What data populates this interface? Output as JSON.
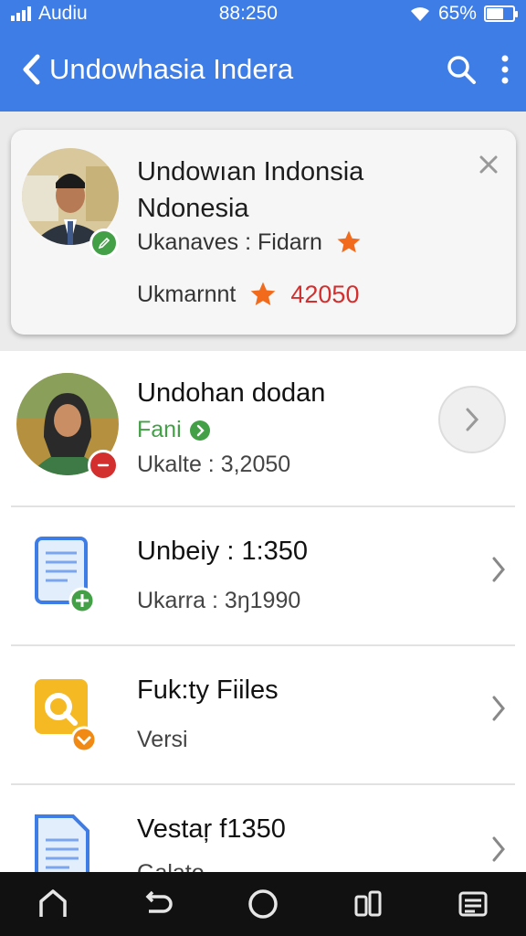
{
  "status_bar": {
    "carrier": "Audiu",
    "time": "88:250",
    "battery_percent": "65%",
    "battery_level": 0.65
  },
  "app_bar": {
    "back_icon": "chevron-left-icon",
    "title": "Undowhasia Indera",
    "actions": [
      "search-icon",
      "more-vertical-icon"
    ]
  },
  "profile_card": {
    "name_line1": "Undowıan Indonsia",
    "name_line2": "Ndonesia",
    "line1_text": "Ukanaves : Fidarn",
    "line2_label": "Ukmarnnt",
    "line2_value": "42050",
    "star_color": "#f26b1d",
    "close_icon": "close-icon"
  },
  "list": [
    {
      "title": "Undohan dodan",
      "status": "Fani",
      "status_color": "#43a047",
      "sub": "Ukalte : 3,2050",
      "icon": "avatar-photo"
    },
    {
      "title": "Unbeiy : 1:350",
      "sub": "Ukarra : 3ŋ1990",
      "icon": "document-add-icon"
    },
    {
      "title": "Fuk:ty Fiiles",
      "sub": "Versi",
      "icon": "folder-search-icon"
    },
    {
      "title": "Vestaŗ f1350",
      "sub": "Galato",
      "icon": "document-icon"
    }
  ],
  "nav_bar": [
    "home-icon",
    "back-icon",
    "circle-home-icon",
    "recents-icon",
    "menu-icon"
  ],
  "colors": {
    "primary": "#3f7de6",
    "accent_red": "#d32f2f",
    "success_green": "#43a047",
    "orange": "#f5a623"
  }
}
